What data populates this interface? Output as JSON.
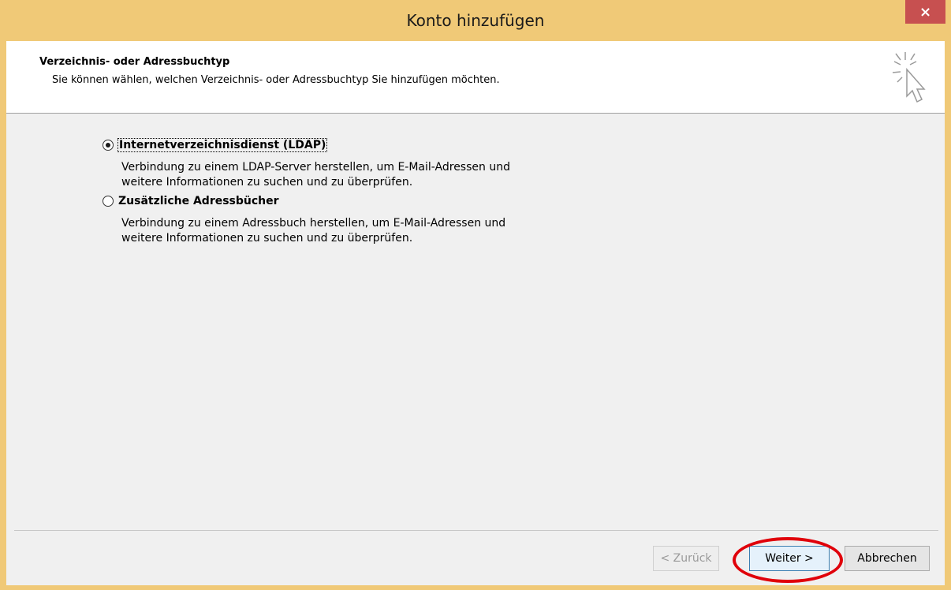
{
  "window": {
    "title": "Konto hinzufügen",
    "close_label": "×"
  },
  "header": {
    "title": "Verzeichnis- oder Adressbuchtyp",
    "subtitle": "Sie können wählen, welchen Verzeichnis- oder Adressbuchtyp Sie hinzufügen möchten."
  },
  "options": [
    {
      "label": "Internetverzeichnisdienst (LDAP)",
      "selected": true,
      "description_lines": [
        "Verbindung zu einem LDAP-Server herstellen, um E-Mail-Adressen und",
        "weitere Informationen zu suchen und zu überprüfen."
      ]
    },
    {
      "label": "Zusätzliche Adressbücher",
      "selected": false,
      "description_lines": [
        "Verbindung zu einem Adressbuch herstellen, um E-Mail-Adressen und",
        "weitere Informationen zu suchen und zu überprüfen."
      ]
    }
  ],
  "buttons": {
    "back": "< Zurück",
    "next": "Weiter >",
    "cancel": "Abbrechen"
  },
  "colors": {
    "titlebar": "#f0c977",
    "close_button": "#c75050",
    "annotation": "#e0000a"
  },
  "icons": {
    "wizard": "cursor-sparkle-icon",
    "close": "close-icon"
  }
}
